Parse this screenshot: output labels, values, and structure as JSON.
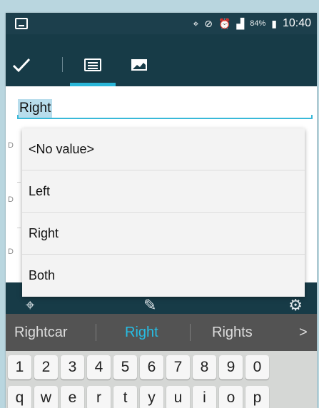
{
  "status_bar": {
    "icons": [
      "image-icon",
      "location-icon",
      "mute-icon",
      "alarm-icon",
      "signal-icon",
      "battery-icon"
    ],
    "battery": "84%",
    "time": "10:40"
  },
  "toolbar": {
    "items": [
      "check-icon",
      "list-view-icon",
      "photo-icon"
    ]
  },
  "editor": {
    "value": "Right"
  },
  "background_labels": [
    "D",
    "D",
    "D"
  ],
  "dropdown": {
    "options": [
      "<No value>",
      "Left",
      "Right",
      "Both"
    ]
  },
  "bottom_bar": {
    "icons": [
      "camera-target-icon",
      "attach-add-icon",
      "settings-icon"
    ]
  },
  "keyboard": {
    "suggestions": [
      "Rightcar",
      "Right",
      "Rights"
    ],
    "more_suggestions": ">",
    "number_row": [
      "1",
      "2",
      "3",
      "4",
      "5",
      "6",
      "7",
      "8",
      "9",
      "0"
    ],
    "letter_row": [
      "q",
      "w",
      "e",
      "r",
      "t",
      "y",
      "u",
      "i",
      "o",
      "p"
    ]
  }
}
